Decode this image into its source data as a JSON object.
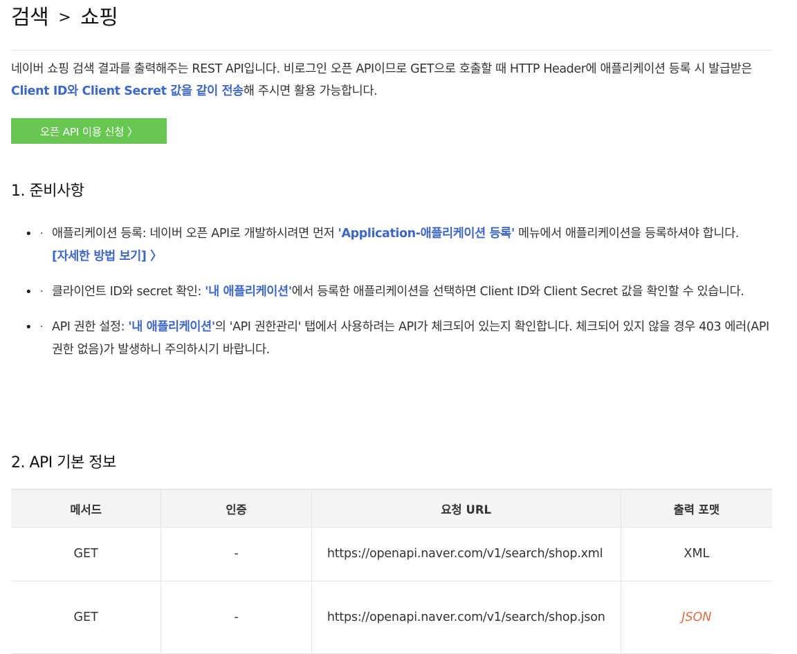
{
  "breadcrumb": {
    "parent": "검색",
    "separator": ">",
    "current": "쇼핑"
  },
  "intro": {
    "part1": "네이버 쇼핑 검색 결과를 출력해주는 REST API입니다. 비로그인 오픈 API이므로 GET으로 호출할 때 HTTP Header에 애플리케이션 등록 시 발급받은 ",
    "highlight": "Client ID와 Client Secret 값을 같이 전송",
    "part2": "해 주시면 활용 가능합니다."
  },
  "apply_button": {
    "label": "오픈 API 이용 신청 〉"
  },
  "section1": {
    "title": "1. 준비사항",
    "items": [
      {
        "bullet": "•",
        "dot": "·",
        "label": "애플리케이션 등록: 네이버 오픈 API로 개발하시려면 먼저 ",
        "link": "'Application-애플리케이션 등록'",
        "rest": " 메뉴에서 애플리케이션을 등록하셔야 합니다.",
        "detail_link": "[자세한 방법 보기] 〉"
      },
      {
        "bullet": "•",
        "dot": "·",
        "label": "클라이언트 ID와 secret 확인: ",
        "link": "'내 애플리케이션'",
        "rest": "에서 등록한 애플리케이션을 선택하면 Client ID와 Client Secret 값을 확인할 수 있습니다."
      },
      {
        "bullet": "•",
        "dot": "·",
        "label": "API 권한 설정: ",
        "link": "'내 애플리케이션'",
        "rest": "의 'API 권한관리' 탭에서 사용하려는 API가 체크되어 있는지 확인합니다. 체크되어 있지 않을 경우 403 에러(API 권한 없음)가 발생하니 주의하시기 바랍니다."
      }
    ]
  },
  "section2": {
    "title": "2. API 기본 정보",
    "table": {
      "headers": [
        "메서드",
        "인증",
        "요청 URL",
        "출력 포맷"
      ],
      "rows": [
        {
          "method": "GET",
          "auth": "-",
          "url": "https://openapi.naver.com/v1/search/shop.xml",
          "format": "XML"
        },
        {
          "method": "GET",
          "auth": "-",
          "url": "https://openapi.naver.com/v1/search/shop.json",
          "format": "JSON"
        }
      ]
    }
  },
  "colors": {
    "accent_blue": "#3e67c6",
    "button_green": "#67c751",
    "json_orange": "#e06c3f"
  }
}
